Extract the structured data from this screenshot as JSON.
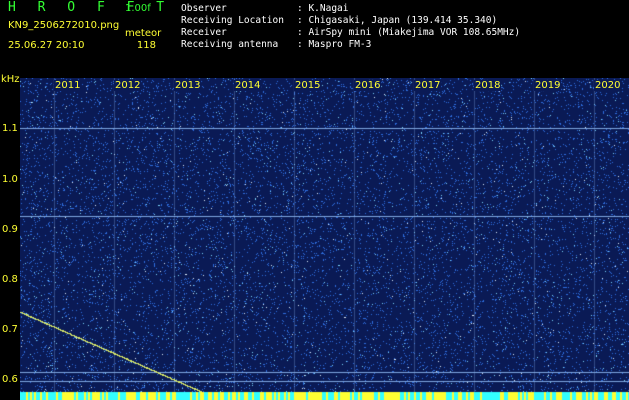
{
  "header": {
    "title": "H R O F F T",
    "version": "1.00f",
    "filename": "KN9_2506272010.png",
    "meteor_label": "meteor",
    "datetime": "25.06.27 20:10",
    "meteor_count": "118"
  },
  "info": {
    "observer_label": "Observer",
    "observer_value": "K.Nagai",
    "location_label": "Receiving Location",
    "location_value": "Chigasaki, Japan (139.414 35.340)",
    "receiver_label": "Receiver",
    "receiver_value": "AirSpy mini (Miakejima VOR 108.65MHz)",
    "antenna_label": "Receiving antenna",
    "antenna_value": "Maspro FM-3"
  },
  "axis": {
    "y_unit": "kHz",
    "y_ticks": [
      "1.1",
      "1.0",
      "0.9",
      "0.8",
      "0.7",
      "0.6"
    ],
    "x_ticks": [
      "2011",
      "2012",
      "2013",
      "2014",
      "2015",
      "2016",
      "2017",
      "2018",
      "2019",
      "2020"
    ]
  },
  "colors": {
    "background": "#0a1a55",
    "noise": "#2f6fe0",
    "noise_bright": "#7fd8ff",
    "grid": "#7fa7e0",
    "label": "#ffff33",
    "title": "#33ff33",
    "trail": "#d6e66a"
  }
}
